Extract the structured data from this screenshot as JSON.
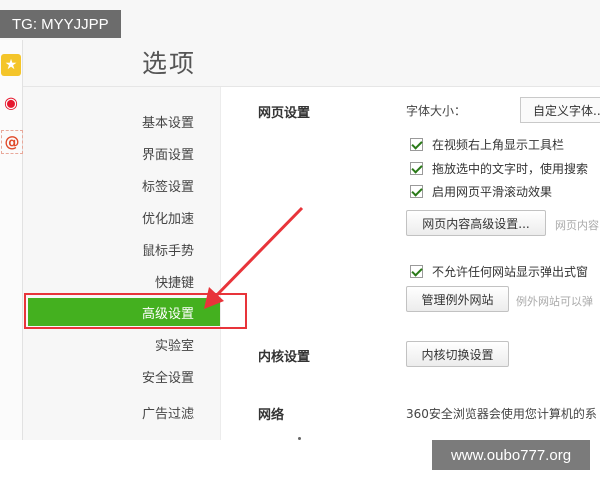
{
  "watermarks": {
    "tg": "TG: MYYJJPP",
    "url": "www.oubo777.org"
  },
  "page_title": "选项",
  "side_strip": [
    {
      "icon": "star-icon",
      "glyph": "★"
    },
    {
      "icon": "weibo-icon",
      "glyph": "◉"
    },
    {
      "icon": "at-icon",
      "glyph": "@"
    }
  ],
  "nav": {
    "items": [
      {
        "label": "基本设置"
      },
      {
        "label": "界面设置"
      },
      {
        "label": "标签设置"
      },
      {
        "label": "优化加速"
      },
      {
        "label": "鼠标手势"
      },
      {
        "label": "快捷键"
      },
      {
        "label": "高级设置",
        "active": true
      },
      {
        "label": "实验室"
      },
      {
        "label": "安全设置"
      },
      {
        "label": "广告过滤"
      }
    ]
  },
  "webpage": {
    "section_label": "网页设置",
    "font_size_label": "字体大小：",
    "font_select_value": "自定义字体...",
    "checks": [
      {
        "label": "在视频右上角显示工具栏",
        "checked": true
      },
      {
        "label": "拖放选中的文字时，使用搜索",
        "checked": true
      },
      {
        "label": "启用网页平滑滚动效果",
        "checked": true
      }
    ],
    "advanced_button": "网页内容高级设置...",
    "advanced_hint": "网页内容",
    "popup_check": {
      "label": "不允许任何网站显示弹出式窗",
      "checked": true
    },
    "exceptions_button": "管理例外网站",
    "exceptions_hint": "例外网站可以弹"
  },
  "kernel": {
    "section_label": "内核设置",
    "button": "内核切换设置"
  },
  "network": {
    "section_label": "网络",
    "description": "360安全浏览器会使用您计算机的系"
  },
  "colors": {
    "accent": "#44b01f",
    "highlight": "#e8343a"
  }
}
